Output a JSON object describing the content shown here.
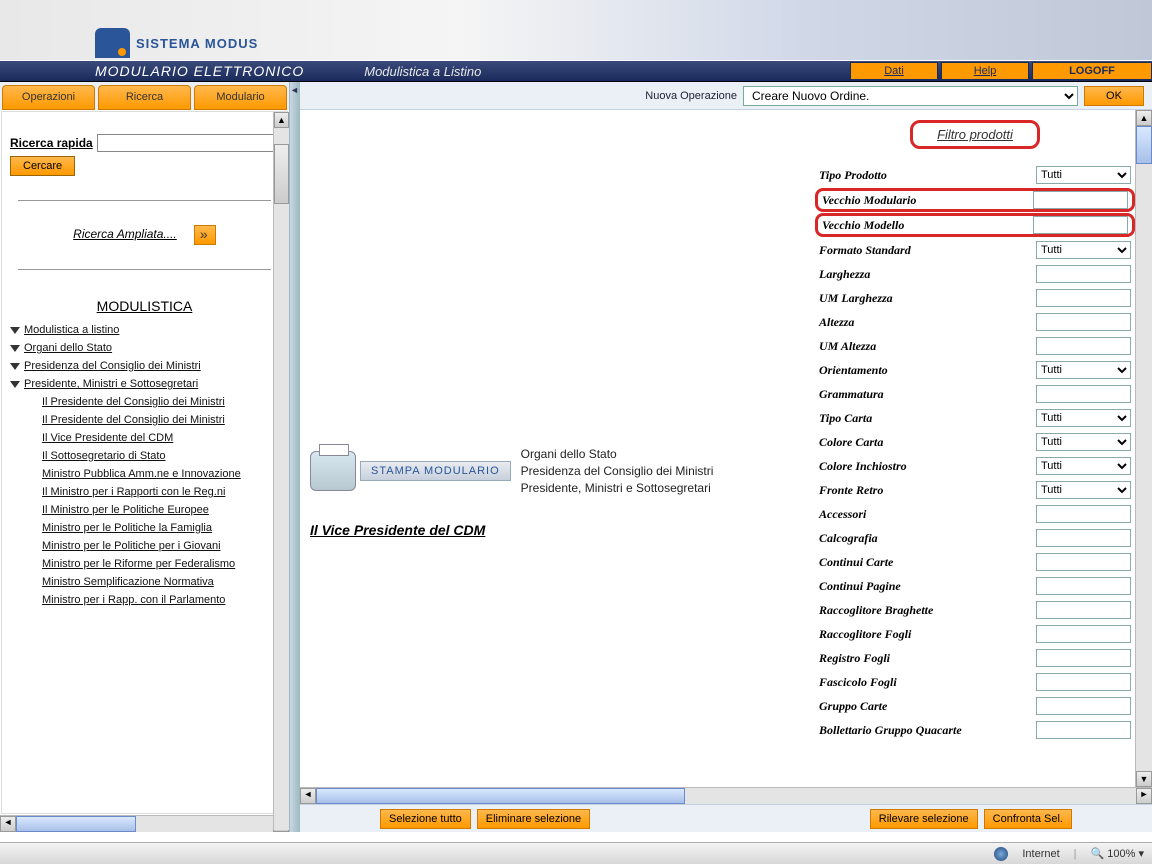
{
  "banner": {
    "brand": "SISTEMA MODUS"
  },
  "header": {
    "title": "MODULARIO ELETTRONICO",
    "subtitle": "Modulistica a Listino",
    "links": {
      "dati": "Dati",
      "help": "Help",
      "logoff": "LOGOFF"
    }
  },
  "sidebar": {
    "tabs": [
      "Operazioni",
      "Ricerca",
      "Modulario"
    ],
    "quick_label": "Ricerca rapida",
    "search_btn": "Cercare",
    "ampliata": "Ricerca Ampliata....",
    "mod_head": "MODULISTICA",
    "tree": [
      "Modulistica a listino",
      "Organi dello Stato",
      "Presidenza del Consiglio dei Ministri",
      "Presidente, Ministri e Sottosegretari"
    ],
    "subtree": [
      "Il Presidente del Consiglio dei Ministri",
      "Il Presidente del Consiglio dei Ministri",
      "Il Vice Presidente del CDM",
      "Il Sottosegretario di Stato",
      "Ministro Pubblica Amm.ne e Innovazione",
      "Il Ministro per i Rapporti con le Reg.ni",
      "Il Ministro per le Politiche Europee",
      "Ministro per le Politiche la Famiglia",
      "Ministro per le Politiche per i Giovani",
      "Ministro per le Riforme per Federalismo",
      "Ministro Semplificazione Normativa",
      "Ministro per i Rapp. con il Parlamento"
    ]
  },
  "opbar": {
    "label": "Nuova Operazione",
    "select": "Creare Nuovo Ordine.",
    "ok": "OK"
  },
  "center": {
    "stampa": "STAMPA MODULARIO",
    "bc1": "Organi dello Stato",
    "bc2": "Presidenza del Consiglio dei Ministri",
    "bc3": "Presidente, Ministri e Sottosegretari",
    "title": "Il Vice Presidente del CDM"
  },
  "filters": {
    "heading": "Filtro prodotti",
    "tutti": "Tutti",
    "rows": [
      {
        "l": "Tipo Prodotto",
        "t": "select"
      },
      {
        "l": "Vecchio Modulario",
        "t": "input",
        "hl": true
      },
      {
        "l": "Vecchio Modello",
        "t": "input",
        "hl": true
      },
      {
        "l": "Formato Standard",
        "t": "select"
      },
      {
        "l": "Larghezza",
        "t": "input"
      },
      {
        "l": "UM Larghezza",
        "t": "input"
      },
      {
        "l": "Altezza",
        "t": "input"
      },
      {
        "l": "UM Altezza",
        "t": "input"
      },
      {
        "l": "Orientamento",
        "t": "select"
      },
      {
        "l": "Grammatura",
        "t": "input"
      },
      {
        "l": "Tipo Carta",
        "t": "select"
      },
      {
        "l": "Colore Carta",
        "t": "select"
      },
      {
        "l": "Colore Inchiostro",
        "t": "select"
      },
      {
        "l": "Fronte Retro",
        "t": "select"
      },
      {
        "l": "Accessori",
        "t": "input"
      },
      {
        "l": "Calcografia",
        "t": "input"
      },
      {
        "l": "Continui Carte",
        "t": "input"
      },
      {
        "l": "Continui Pagine",
        "t": "input"
      },
      {
        "l": "Raccoglitore Braghette",
        "t": "input"
      },
      {
        "l": "Raccoglitore Fogli",
        "t": "input"
      },
      {
        "l": "Registro Fogli",
        "t": "input"
      },
      {
        "l": "Fascicolo Fogli",
        "t": "input"
      },
      {
        "l": "Gruppo Carte",
        "t": "input"
      },
      {
        "l": "Bollettario Gruppo Quacarte",
        "t": "input"
      }
    ]
  },
  "actions": {
    "sel_all": "Selezione tutto",
    "del_sel": "Eliminare selezione",
    "get_sel": "Rilevare selezione",
    "compare": "Confronta Sel."
  },
  "status": {
    "zone": "Internet",
    "zoom": "100%"
  }
}
